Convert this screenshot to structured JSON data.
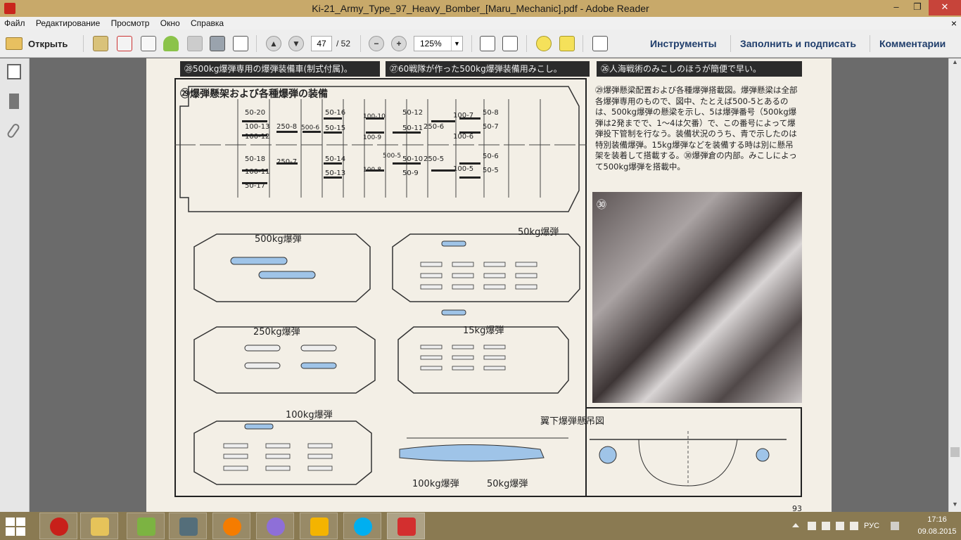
{
  "window": {
    "title": "Ki-21_Army_Type_97_Heavy_Bomber_[Maru_Mechanic].pdf - Adobe Reader",
    "minimize": "‒",
    "restore": "❐",
    "close": "✕"
  },
  "menu": {
    "items": [
      "Файл",
      "Редактирование",
      "Просмотр",
      "Окно",
      "Справка"
    ],
    "close_label": "×"
  },
  "toolbar": {
    "open_label": "Открыть",
    "page_current": "47",
    "page_total": "/ 52",
    "zoom": "125%",
    "tools_label": "Инструменты",
    "fill_sign_label": "Заполнить и подписать",
    "comments_label": "Комментарии"
  },
  "document": {
    "captions": {
      "c28": "㉘500kg爆弾専用の爆弾装備車(制式付属)。",
      "c27": "㉗60戦隊が作った500kg爆弾装備用みこし。",
      "c26": "㉖人海戦術のみこしのほうが簡便で早い。"
    },
    "diagram_title": "㉙爆弾懸架および各種爆弾の装備",
    "rack_labels_top": [
      "50-20",
      "100-13",
      "100-12",
      "250-8",
      "500-6",
      "50-16",
      "50-15",
      "100-10",
      "100-9",
      "50-12",
      "50-11",
      "250-6",
      "100-7",
      "100-6",
      "50-8",
      "50-7"
    ],
    "rack_labels_bottom": [
      "50-18",
      "100-11",
      "50-17",
      "250-7",
      "50-14",
      "50-13",
      "100-8",
      "500-5",
      "50-10",
      "50-9",
      "250-5",
      "100-5",
      "50-6",
      "50-5"
    ],
    "panel_labels": {
      "p500": "500kg爆弾",
      "p50": "50kg爆弾",
      "p250": "250kg爆弾",
      "p15": "15kg爆弾",
      "p100": "100kg爆弾",
      "wing_title": "翼下爆弾懸吊図",
      "wing_100": "100kg爆弾",
      "wing_50": "50kg爆弾"
    },
    "description": "㉙爆弾懸梁配置および各種爆弾搭載図。爆弾懸梁は全部各爆弾専用のもので、図中、たとえば500-5とあるのは、500kg爆弾の懸梁を示し、5は爆弾番号（500kg爆弾は2発までで、1～4は欠番）で、この番号によって爆弾投下管制を行なう。装備状況のうち、青で示したのは特別装備爆弾。15kg爆弾などを装備する時は別に懸吊架を装着して搭載する。㉚爆弾倉の内部。みこしによって500kg爆弾を搭載中。",
    "photo_label": "㉚",
    "page_number": "93"
  },
  "taskbar": {
    "language": "РУС",
    "time": "17:16",
    "date": "09.08.2015"
  },
  "colors": {
    "titlebar": "#c8a96a",
    "highlight_blue": "#9fc4e8",
    "caption_bg": "#2b2b2b",
    "page_bg": "#f3efe6"
  }
}
